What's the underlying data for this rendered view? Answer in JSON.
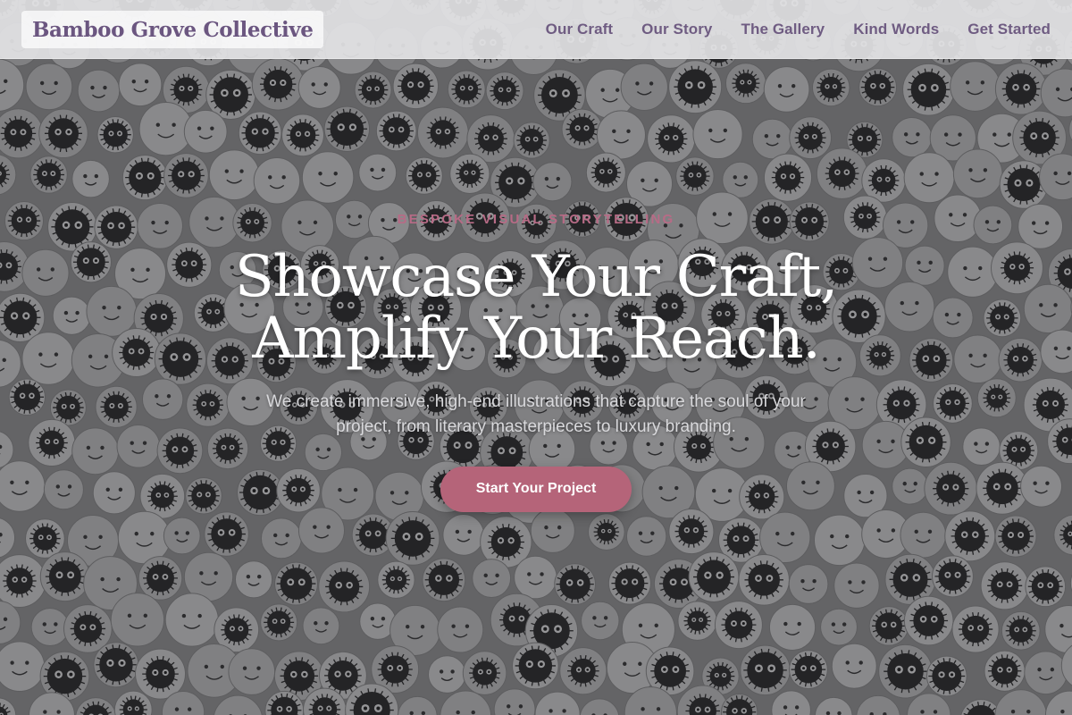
{
  "header": {
    "brand": "Bamboo Grove Collective",
    "nav": [
      {
        "label": "Our Craft"
      },
      {
        "label": "Our Story"
      },
      {
        "label": "The Gallery"
      },
      {
        "label": "Kind Words"
      },
      {
        "label": "Get Started"
      }
    ]
  },
  "hero": {
    "eyebrow": "BESPOKE VISUAL STORYTELLING",
    "headline_line1": "Showcase Your Craft,",
    "headline_line2": "Amplify Your Reach.",
    "subtext": "We create immersive, high-end illustrations that capture the soul of your project, from literary masterpieces to luxury branding.",
    "cta_label": "Start Your Project",
    "background_description_icon": "doodle-pattern-image"
  },
  "colors": {
    "brand_purple": "#6b5680",
    "accent_rose": "#b56479",
    "eyebrow_rose": "#b76b86"
  }
}
